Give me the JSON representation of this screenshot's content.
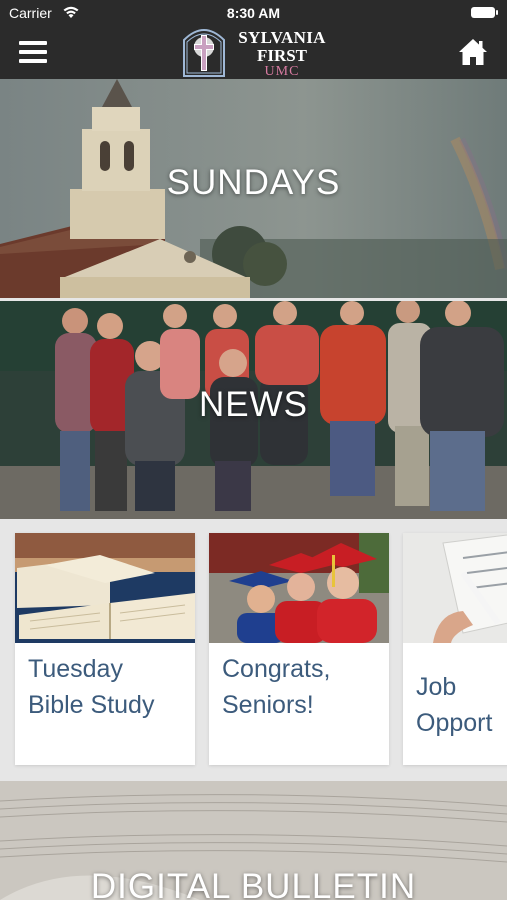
{
  "status_bar": {
    "carrier": "Carrier",
    "time": "8:30 AM"
  },
  "header": {
    "logo_line1": "SYLVANIA",
    "logo_line2": "FIRST",
    "logo_line3": "UMC"
  },
  "banners": {
    "sundays": "SUNDAYS",
    "news": "NEWS",
    "bulletin": "DIGITAL BULLETIN"
  },
  "cards": [
    {
      "line1": "Tuesday",
      "line2": "Bible Study"
    },
    {
      "line1": "Congrats,",
      "line2": "Seniors!"
    },
    {
      "line1": "Job",
      "line2": "Opport"
    }
  ],
  "colors": {
    "header_bg": "#2b2b2b",
    "card_title": "#3c5b7c",
    "logo_accent": "#d77aa0"
  }
}
